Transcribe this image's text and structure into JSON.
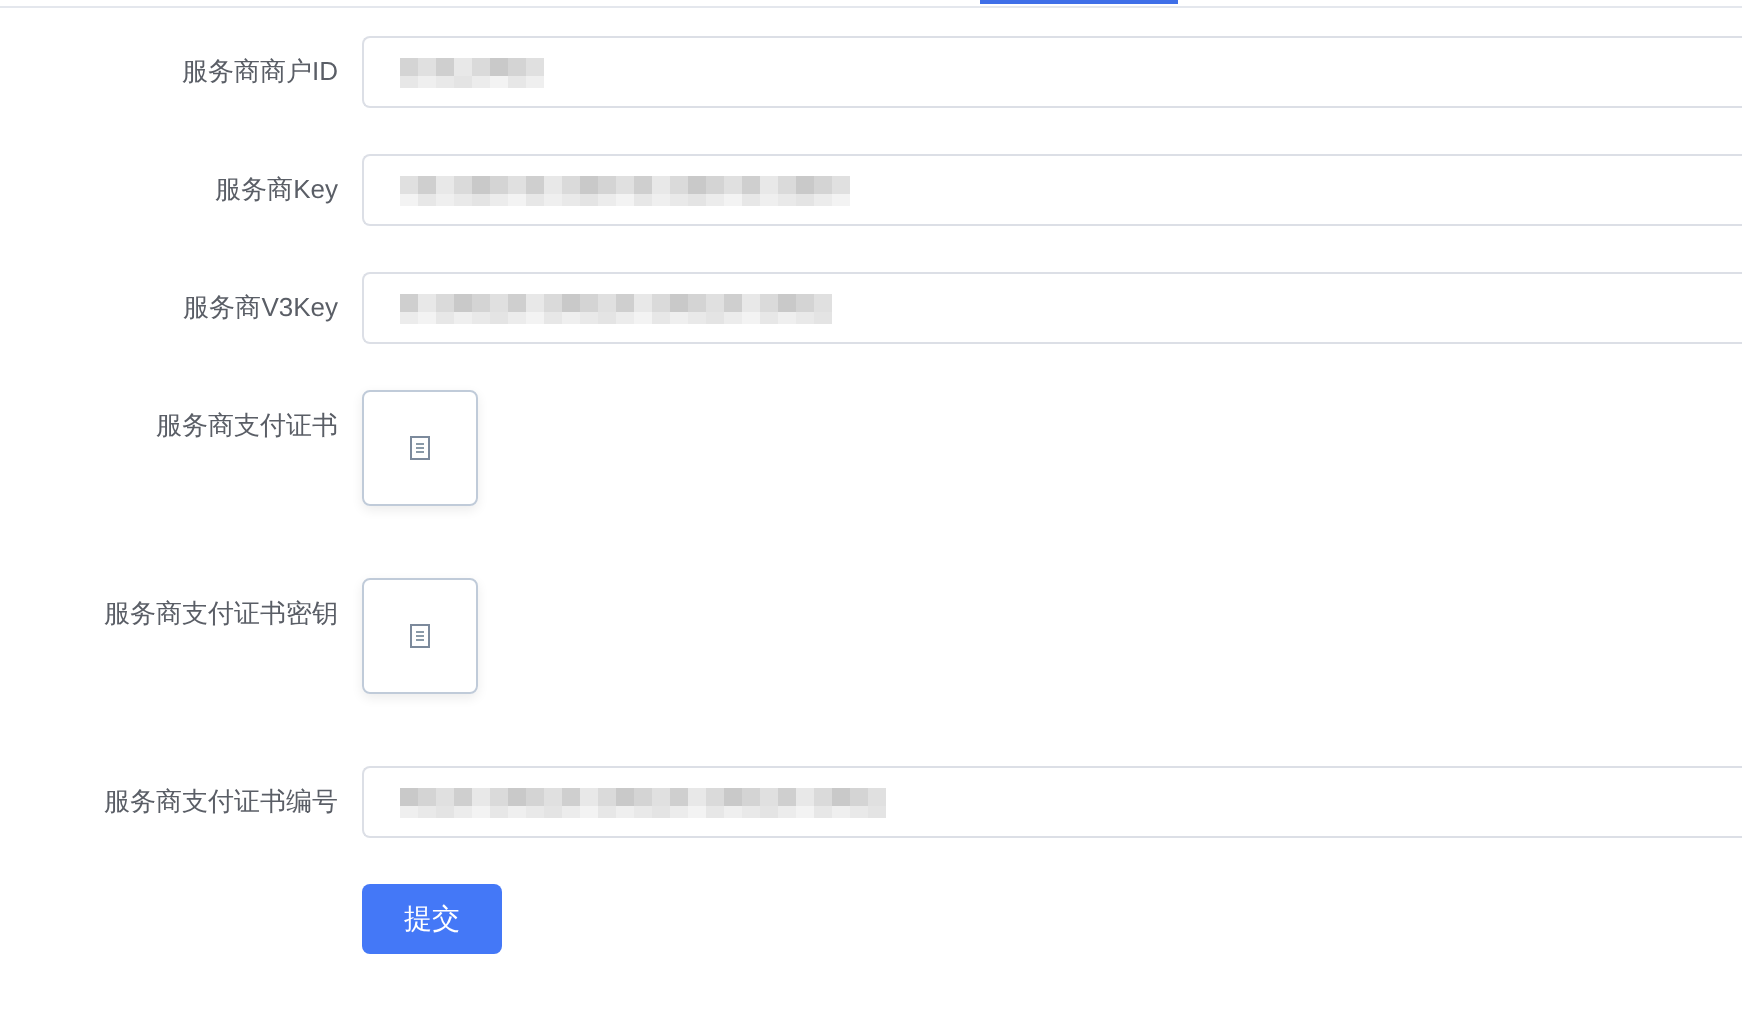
{
  "tab_indicator": {
    "selected": true
  },
  "form": {
    "fields": [
      {
        "kind": "text",
        "label": "服务商商户ID",
        "redacted": true
      },
      {
        "kind": "text",
        "label": "服务商Key",
        "redacted": true
      },
      {
        "kind": "text",
        "label": "服务商V3Key",
        "redacted": true
      },
      {
        "kind": "file",
        "label": "服务商支付证书"
      },
      {
        "kind": "file",
        "label": "服务商支付证书密钥"
      },
      {
        "kind": "text",
        "label": "服务商支付证书编号",
        "redacted": true
      }
    ],
    "submit": {
      "label": "提交"
    }
  }
}
